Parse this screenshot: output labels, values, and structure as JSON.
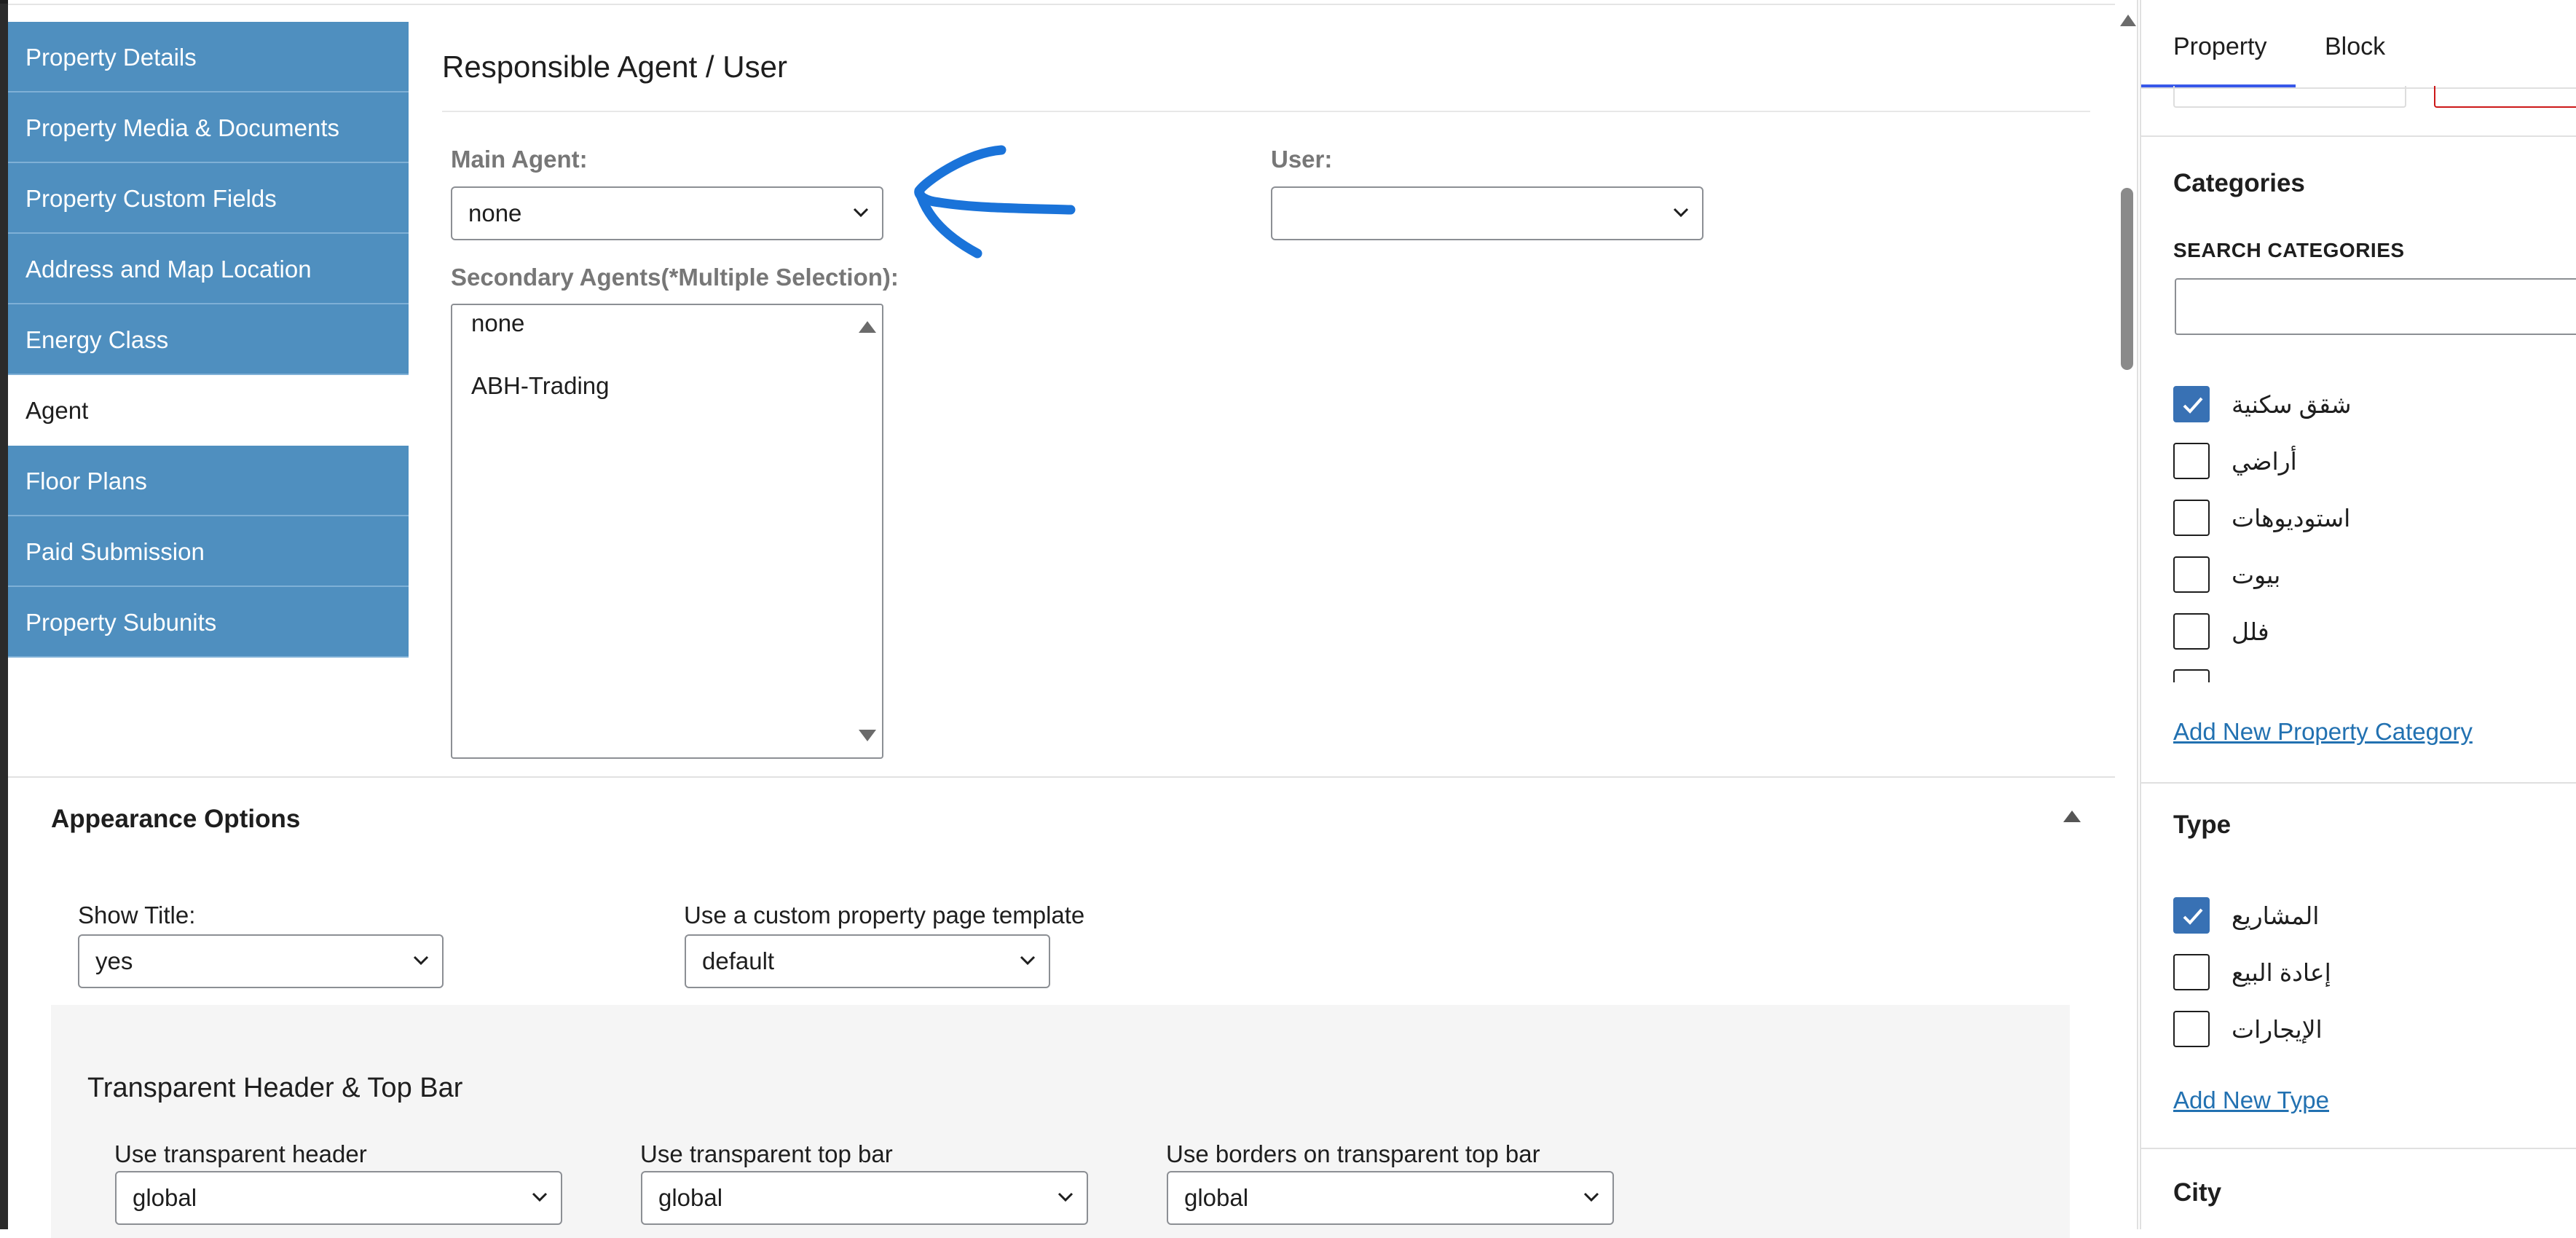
{
  "tabs": [
    {
      "label": "Property Details",
      "active": false
    },
    {
      "label": "Property Media & Documents",
      "active": false
    },
    {
      "label": "Property Custom Fields",
      "active": false
    },
    {
      "label": "Address and Map Location",
      "active": false
    },
    {
      "label": "Energy Class",
      "active": false
    },
    {
      "label": "Agent",
      "active": true
    },
    {
      "label": "Floor Plans",
      "active": false
    },
    {
      "label": "Paid Submission",
      "active": false
    },
    {
      "label": "Property Subunits",
      "active": false
    }
  ],
  "agent_section": {
    "title": "Responsible Agent / User",
    "main_agent_label": "Main Agent:",
    "main_agent_value": "none",
    "user_label": "User:",
    "user_value": "",
    "secondary_label": "Secondary Agents(*Multiple Selection):",
    "secondary_options": [
      "none",
      "ABH-Trading"
    ]
  },
  "appearance": {
    "title": "Appearance Options",
    "show_title_label": "Show Title:",
    "show_title_value": "yes",
    "template_label": "Use a custom property page template",
    "template_value": "default",
    "transparent_title": "Transparent Header & Top Bar",
    "transparent_header_label": "Use transparent header",
    "transparent_header_value": "global",
    "transparent_topbar_label": "Use transparent top bar",
    "transparent_topbar_value": "global",
    "borders_label": "Use borders on transparent top bar",
    "borders_value": "global"
  },
  "sidebar": {
    "tabs": [
      "Property",
      "Block"
    ],
    "categories_title": "Categories",
    "search_label": "SEARCH CATEGORIES",
    "categories": [
      {
        "label": "شقق سكنية",
        "checked": true
      },
      {
        "label": "أراضي",
        "checked": false
      },
      {
        "label": "استوديوهات",
        "checked": false
      },
      {
        "label": "بيوت",
        "checked": false
      },
      {
        "label": "فلل",
        "checked": false
      }
    ],
    "add_category": "Add New Property Category",
    "type_title": "Type",
    "types": [
      {
        "label": "المشاريع",
        "checked": true
      },
      {
        "label": "إعادة البيع",
        "checked": false
      },
      {
        "label": "الإيجارات",
        "checked": false
      }
    ],
    "add_type": "Add New Type",
    "city_title": "City"
  },
  "colors": {
    "tab_bg": "#4f8fbf",
    "accent_blue": "#3871b4",
    "link_blue": "#2271b1",
    "annotation_arrow": "#1a73d9"
  }
}
